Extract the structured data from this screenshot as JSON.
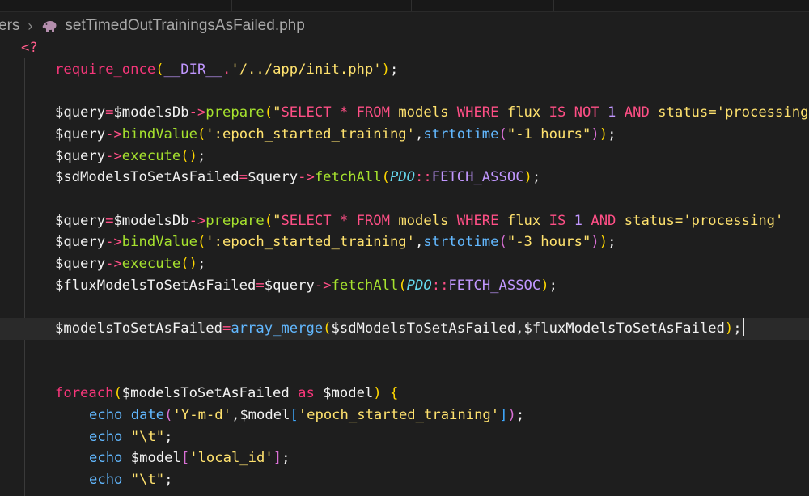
{
  "breadcrumb": {
    "parent": "ers",
    "separator": "›",
    "file_icon": "php-elephant-icon",
    "file_name": "setTimedOutTrainingsAsFailed.php"
  },
  "colors": {
    "background": "#1e1e1e",
    "keyword": "#f7367a",
    "function": "#a6e22e",
    "builtin_function": "#62b8ff",
    "string": "#ffe26e",
    "constant": "#c197ff",
    "class": "#66d9ef"
  },
  "code_lines": [
    [
      {
        "t": "<?",
        "c": "tag"
      }
    ],
    [
      {
        "t": "require_once",
        "c": "kw"
      },
      {
        "t": "(",
        "c": "b1"
      },
      {
        "t": "__DIR__",
        "c": "const"
      },
      {
        "t": ".",
        "c": "op"
      },
      {
        "t": "'/../app/init.php'",
        "c": "str"
      },
      {
        "t": ")",
        "c": "b1"
      },
      {
        "t": ";",
        "c": "plain"
      }
    ],
    [],
    [
      {
        "t": "$query",
        "c": "var"
      },
      {
        "t": "=",
        "c": "op"
      },
      {
        "t": "$modelsDb",
        "c": "var"
      },
      {
        "t": "->",
        "c": "op"
      },
      {
        "t": "prepare",
        "c": "fn"
      },
      {
        "t": "(",
        "c": "b1"
      },
      {
        "t": "\"",
        "c": "str"
      },
      {
        "t": "SELECT * FROM ",
        "c": "sql"
      },
      {
        "t": "models ",
        "c": "str"
      },
      {
        "t": "WHERE ",
        "c": "sql"
      },
      {
        "t": "flux ",
        "c": "str"
      },
      {
        "t": "IS NOT ",
        "c": "sql"
      },
      {
        "t": "1 ",
        "c": "num"
      },
      {
        "t": "AND ",
        "c": "sql"
      },
      {
        "t": "status=",
        "c": "str"
      },
      {
        "t": "'processing'",
        "c": "str"
      }
    ],
    [
      {
        "t": "$query",
        "c": "var"
      },
      {
        "t": "->",
        "c": "op"
      },
      {
        "t": "bindValue",
        "c": "fn"
      },
      {
        "t": "(",
        "c": "b1"
      },
      {
        "t": "':epoch_started_training'",
        "c": "str"
      },
      {
        "t": ",",
        "c": "plain"
      },
      {
        "t": "strtotime",
        "c": "fnb"
      },
      {
        "t": "(",
        "c": "b2"
      },
      {
        "t": "\"-1 hours\"",
        "c": "str"
      },
      {
        "t": ")",
        "c": "b2"
      },
      {
        "t": ")",
        "c": "b1"
      },
      {
        "t": ";",
        "c": "plain"
      }
    ],
    [
      {
        "t": "$query",
        "c": "var"
      },
      {
        "t": "->",
        "c": "op"
      },
      {
        "t": "execute",
        "c": "fn"
      },
      {
        "t": "()",
        "c": "b1"
      },
      {
        "t": ";",
        "c": "plain"
      }
    ],
    [
      {
        "t": "$sdModelsToSetAsFailed",
        "c": "var"
      },
      {
        "t": "=",
        "c": "op"
      },
      {
        "t": "$query",
        "c": "var"
      },
      {
        "t": "->",
        "c": "op"
      },
      {
        "t": "fetchAll",
        "c": "fn"
      },
      {
        "t": "(",
        "c": "b1"
      },
      {
        "t": "PDO",
        "c": "cls"
      },
      {
        "t": "::",
        "c": "op"
      },
      {
        "t": "FETCH_ASSOC",
        "c": "const"
      },
      {
        "t": ")",
        "c": "b1"
      },
      {
        "t": ";",
        "c": "plain"
      }
    ],
    [],
    [
      {
        "t": "$query",
        "c": "var"
      },
      {
        "t": "=",
        "c": "op"
      },
      {
        "t": "$modelsDb",
        "c": "var"
      },
      {
        "t": "->",
        "c": "op"
      },
      {
        "t": "prepare",
        "c": "fn"
      },
      {
        "t": "(",
        "c": "b1"
      },
      {
        "t": "\"",
        "c": "str"
      },
      {
        "t": "SELECT * FROM ",
        "c": "sql"
      },
      {
        "t": "models ",
        "c": "str"
      },
      {
        "t": "WHERE ",
        "c": "sql"
      },
      {
        "t": "flux ",
        "c": "str"
      },
      {
        "t": "IS ",
        "c": "sql"
      },
      {
        "t": "1 ",
        "c": "num"
      },
      {
        "t": "AND ",
        "c": "sql"
      },
      {
        "t": "status=",
        "c": "str"
      },
      {
        "t": "'processing'",
        "c": "str"
      }
    ],
    [
      {
        "t": "$query",
        "c": "var"
      },
      {
        "t": "->",
        "c": "op"
      },
      {
        "t": "bindValue",
        "c": "fn"
      },
      {
        "t": "(",
        "c": "b1"
      },
      {
        "t": "':epoch_started_training'",
        "c": "str"
      },
      {
        "t": ",",
        "c": "plain"
      },
      {
        "t": "strtotime",
        "c": "fnb"
      },
      {
        "t": "(",
        "c": "b2"
      },
      {
        "t": "\"-3 hours\"",
        "c": "str"
      },
      {
        "t": ")",
        "c": "b2"
      },
      {
        "t": ")",
        "c": "b1"
      },
      {
        "t": ";",
        "c": "plain"
      }
    ],
    [
      {
        "t": "$query",
        "c": "var"
      },
      {
        "t": "->",
        "c": "op"
      },
      {
        "t": "execute",
        "c": "fn"
      },
      {
        "t": "()",
        "c": "b1"
      },
      {
        "t": ";",
        "c": "plain"
      }
    ],
    [
      {
        "t": "$fluxModelsToSetAsFailed",
        "c": "var"
      },
      {
        "t": "=",
        "c": "op"
      },
      {
        "t": "$query",
        "c": "var"
      },
      {
        "t": "->",
        "c": "op"
      },
      {
        "t": "fetchAll",
        "c": "fn"
      },
      {
        "t": "(",
        "c": "b1"
      },
      {
        "t": "PDO",
        "c": "cls"
      },
      {
        "t": "::",
        "c": "op"
      },
      {
        "t": "FETCH_ASSOC",
        "c": "const"
      },
      {
        "t": ")",
        "c": "b1"
      },
      {
        "t": ";",
        "c": "plain"
      }
    ],
    [],
    [
      {
        "t": "$modelsToSetAsFailed",
        "c": "var"
      },
      {
        "t": "=",
        "c": "op"
      },
      {
        "t": "array_merge",
        "c": "fnb"
      },
      {
        "t": "(",
        "c": "b1"
      },
      {
        "t": "$sdModelsToSetAsFailed",
        "c": "var"
      },
      {
        "t": ",",
        "c": "plain"
      },
      {
        "t": "$fluxModelsToSetAsFailed",
        "c": "var"
      },
      {
        "t": ")",
        "c": "b1"
      },
      {
        "t": ";",
        "c": "plain"
      }
    ],
    [],
    [],
    [
      {
        "t": "foreach",
        "c": "kw"
      },
      {
        "t": "(",
        "c": "b1"
      },
      {
        "t": "$modelsToSetAsFailed",
        "c": "var"
      },
      {
        "t": " as ",
        "c": "kw"
      },
      {
        "t": "$model",
        "c": "var"
      },
      {
        "t": ")",
        "c": "b1"
      },
      {
        "t": " ",
        "c": "plain"
      },
      {
        "t": "{",
        "c": "b1"
      }
    ],
    [
      {
        "t": "echo",
        "c": "fnb"
      },
      {
        "t": " ",
        "c": "plain"
      },
      {
        "t": "date",
        "c": "fnb"
      },
      {
        "t": "(",
        "c": "b2"
      },
      {
        "t": "'Y-m-d'",
        "c": "str"
      },
      {
        "t": ",",
        "c": "plain"
      },
      {
        "t": "$model",
        "c": "var"
      },
      {
        "t": "[",
        "c": "b3"
      },
      {
        "t": "'epoch_started_training'",
        "c": "str"
      },
      {
        "t": "]",
        "c": "b3"
      },
      {
        "t": ")",
        "c": "b2"
      },
      {
        "t": ";",
        "c": "plain"
      }
    ],
    [
      {
        "t": "echo",
        "c": "fnb"
      },
      {
        "t": " ",
        "c": "plain"
      },
      {
        "t": "\"\\t\"",
        "c": "str"
      },
      {
        "t": ";",
        "c": "plain"
      }
    ],
    [
      {
        "t": "echo",
        "c": "fnb"
      },
      {
        "t": " ",
        "c": "plain"
      },
      {
        "t": "$model",
        "c": "var"
      },
      {
        "t": "[",
        "c": "b2"
      },
      {
        "t": "'local_id'",
        "c": "str"
      },
      {
        "t": "]",
        "c": "b2"
      },
      {
        "t": ";",
        "c": "plain"
      }
    ],
    [
      {
        "t": "echo",
        "c": "fnb"
      },
      {
        "t": " ",
        "c": "plain"
      },
      {
        "t": "\"\\t\"",
        "c": "str"
      },
      {
        "t": ";",
        "c": "plain"
      }
    ]
  ]
}
